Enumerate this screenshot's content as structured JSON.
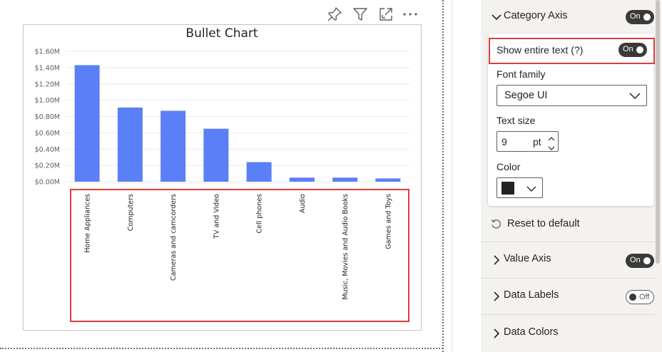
{
  "visual_header": {
    "icons": [
      "pin-icon",
      "filter-icon",
      "focus-mode-icon",
      "more-options-icon"
    ]
  },
  "chart_data": {
    "type": "bar",
    "title": "Bullet Chart",
    "categories": [
      "Home Appliances",
      "Computers",
      "Cameras and camcorders",
      "TV and Video",
      "Cell phones",
      "Audio",
      "Music, Movies and Audio Books",
      "Games and Toys"
    ],
    "values": [
      1.43,
      0.91,
      0.87,
      0.65,
      0.24,
      0.05,
      0.05,
      0.04
    ],
    "value_unit": "millions",
    "ylim": [
      0,
      1.6
    ],
    "yticks": [
      "$0.00M",
      "$0.20M",
      "$0.40M",
      "$0.60M",
      "$0.80M",
      "$1.00M",
      "$1.20M",
      "$1.40M",
      "$1.60M"
    ],
    "grid": true,
    "legend": "none",
    "bar_color": "#5b7ff7"
  },
  "format_pane": {
    "category_axis": {
      "label": "Category Axis",
      "toggle": "On",
      "show_entire_text_label": "Show entire text (?)",
      "show_entire_text_toggle": "On",
      "font_family_label": "Font family",
      "font_family_value": "Segoe UI",
      "text_size_label": "Text size",
      "text_size_value": "9",
      "text_size_unit": "pt",
      "color_label": "Color",
      "color_value": "#252423",
      "reset_label": "Reset to default"
    },
    "value_axis": {
      "label": "Value Axis",
      "toggle": "On"
    },
    "data_labels": {
      "label": "Data Labels",
      "toggle": "Off"
    },
    "data_colors": {
      "label": "Data Colors"
    }
  },
  "colors": {
    "highlight": "#e03c3c",
    "toggle_on": "#3b3a39",
    "pane_background": "#f3f2f1"
  }
}
